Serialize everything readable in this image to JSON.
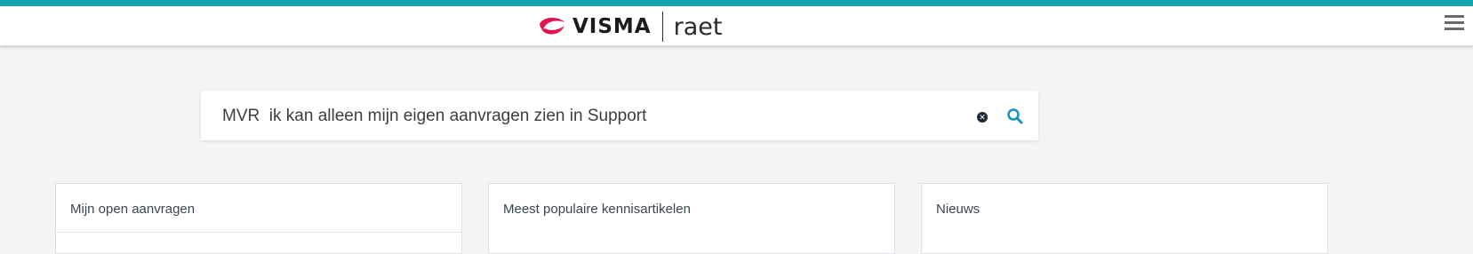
{
  "header": {
    "brand_name": "VISMA",
    "brand_sub": "raet",
    "menu_icon": "hamburger-menu-icon",
    "accent_color": "#0ea5b0",
    "brand_mark_color": "#e4134f"
  },
  "search": {
    "value": "MVR  ik kan alleen mijn eigen aanvragen zien in Support",
    "clear_icon": "clear-x-icon",
    "search_icon": "search-icon",
    "search_icon_color": "#1592c5"
  },
  "cards": [
    {
      "title": "Mijn open aanvragen"
    },
    {
      "title": "Meest populaire kennisartikelen"
    },
    {
      "title": "Nieuws"
    }
  ]
}
